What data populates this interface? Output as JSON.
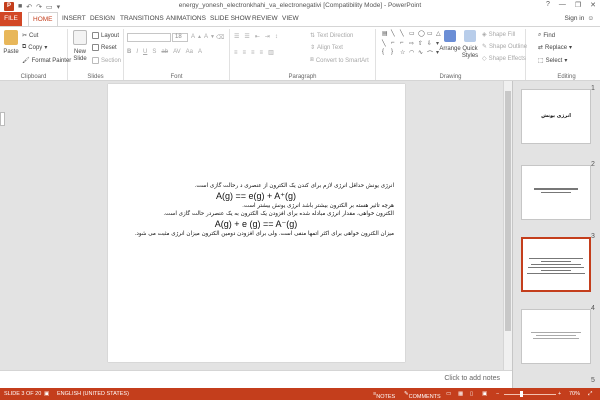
{
  "window": {
    "title": "energy_yonesh_electronkhahi_va_electronegativi [Compatibility Mode] - PowerPoint",
    "app_logo": "P",
    "controls": [
      "?",
      "—",
      "❐",
      "✕"
    ],
    "sign_in": "Sign in"
  },
  "tabs": [
    "FILE",
    "HOME",
    "INSERT",
    "DESIGN",
    "TRANSITIONS",
    "ANIMATIONS",
    "SLIDE SHOW",
    "REVIEW",
    "VIEW"
  ],
  "active_tab": "HOME",
  "ribbon": {
    "clipboard": {
      "paste": "Paste",
      "cut": "Cut",
      "copy": "Copy",
      "format_painter": "Format Painter",
      "label": "Clipboard"
    },
    "slides": {
      "new_slide": "New Slide",
      "layout": "Layout",
      "reset": "Reset",
      "section": "Section",
      "label": "Slides"
    },
    "font": {
      "font_name": "",
      "font_size": "18",
      "label": "Font"
    },
    "paragraph": {
      "text_direction": "Text Direction",
      "align_text": "Align Text",
      "convert_smartart": "Convert to SmartArt",
      "label": "Paragraph"
    },
    "drawing": {
      "arrange": "Arrange",
      "quick_styles": "Quick Styles",
      "shape_fill": "Shape Fill",
      "shape_outline": "Shape Outline",
      "shape_effects": "Shape Effects",
      "label": "Drawing"
    },
    "editing": {
      "find": "Find",
      "replace": "Replace",
      "select": "Select",
      "label": "Editing"
    }
  },
  "slide": {
    "lines": [
      {
        "text": "انرژی یونش حداقل انرژی لازم برای کندن یک الکترون از عنصری د رحالت گازی است.",
        "kind": "text"
      },
      {
        "text": "A(g) == e(g) + A⁺(g)",
        "kind": "formula"
      },
      {
        "text": "هرچه تاثیر هسته بر الکترون بیشتر باشد انرژی یونش بیشتر است.",
        "kind": "text"
      },
      {
        "text": "الکترون خواهی، مقدار انرژی مبادله شده برای افزودن یک الکترون به یک عنصردر حالت گازی است.",
        "kind": "text"
      },
      {
        "text": "A(g) + e (g) == A⁻(g)",
        "kind": "formula"
      },
      {
        "text": "میزان الکترون خواهی برای اکثر اتمها منفی است. ولی برای افزودن دومین الکترون میزان انرژی مثبت می شود.",
        "kind": "text"
      }
    ]
  },
  "notes_placeholder": "Click to add notes",
  "thumbnails": [
    {
      "num": "1",
      "title": "انرژی یونش",
      "selected": false
    },
    {
      "num": "2",
      "title": "",
      "selected": false
    },
    {
      "num": "3",
      "title": "",
      "selected": true
    },
    {
      "num": "4",
      "title": "",
      "selected": false
    },
    {
      "num": "5",
      "title": "",
      "selected": false
    }
  ],
  "status": {
    "slide_count": "SLIDE 3 OF 20",
    "language": "ENGLISH (UNITED STATES)",
    "notes": "NOTES",
    "comments": "COMMENTS",
    "zoom": "70%"
  },
  "colors": {
    "accent": "#c43e1c",
    "file_tab": "#d24726"
  }
}
